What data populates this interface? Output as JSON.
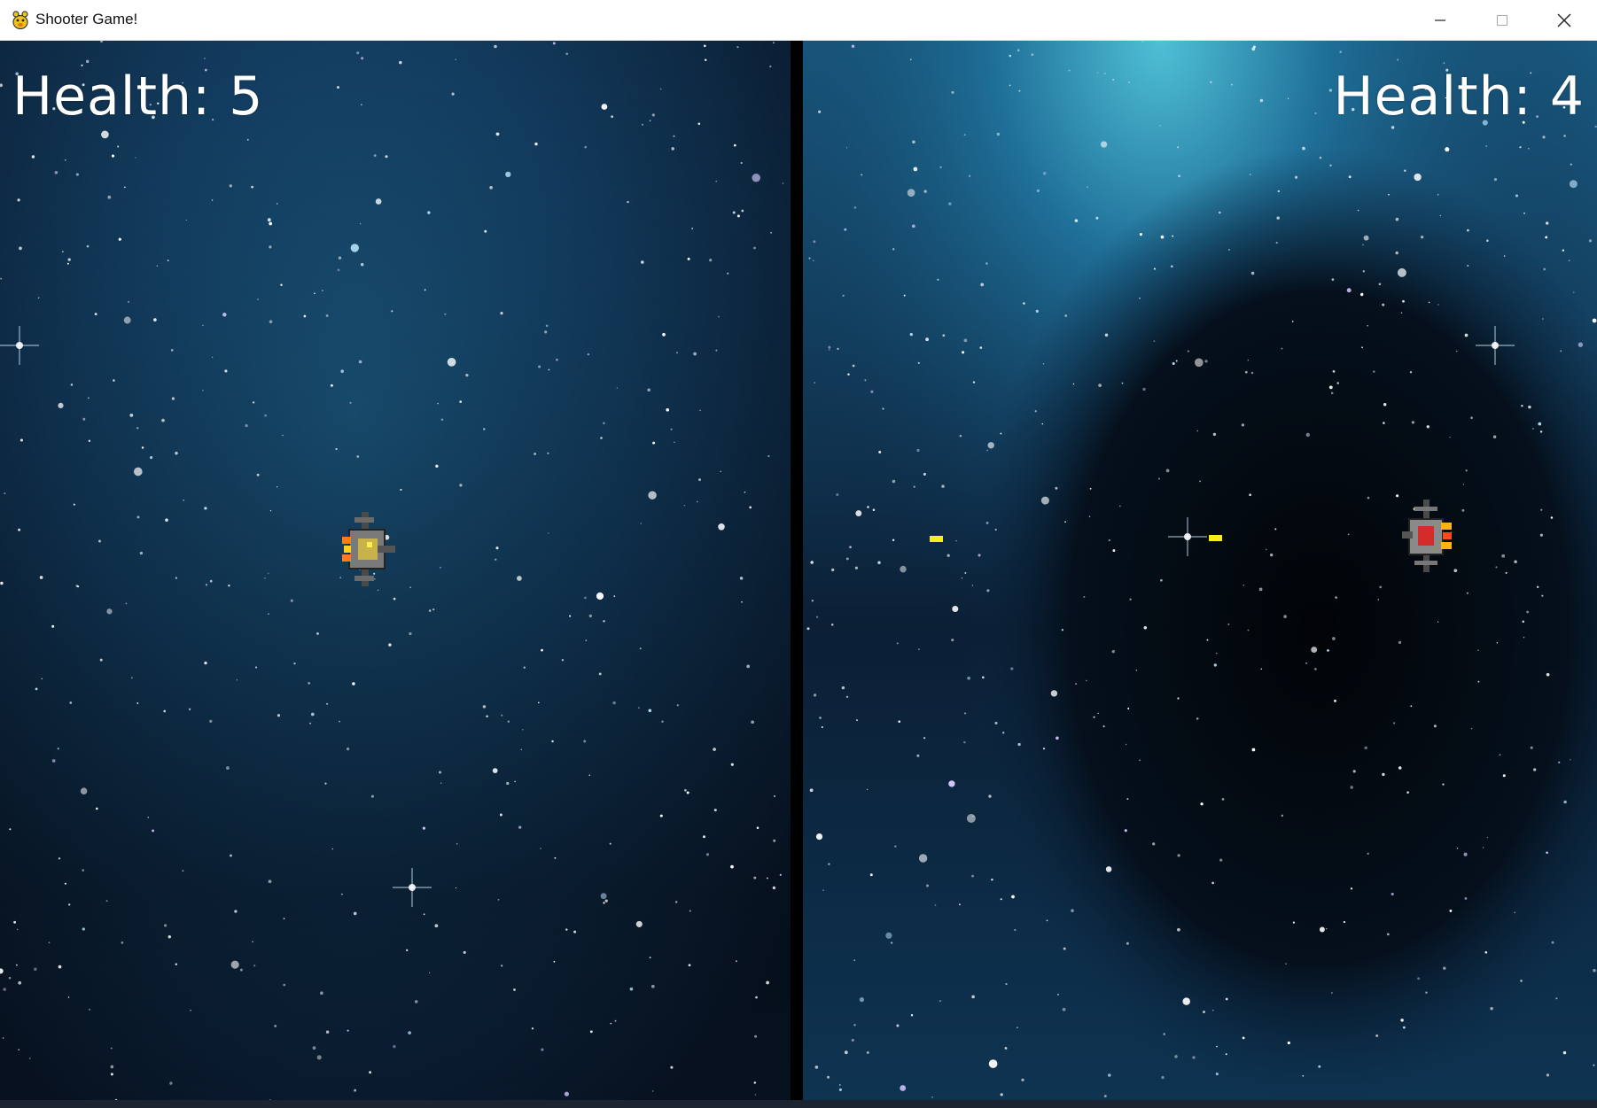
{
  "window": {
    "title": "Shooter Game!",
    "icon": "python-snake-icon"
  },
  "controls": {
    "minimize": "minimize-icon",
    "maximize": "maximize-icon",
    "close": "close-icon"
  },
  "hud": {
    "left_health_label": "Health: 5",
    "right_health_label": "Health: 4",
    "left_health_value": 5,
    "right_health_value": 4
  },
  "colors": {
    "bullet": "#f7ee16",
    "divider": "#000000",
    "hud_text": "#ffffff",
    "space_light": "#1f6c8e",
    "space_dark": "#020409"
  }
}
